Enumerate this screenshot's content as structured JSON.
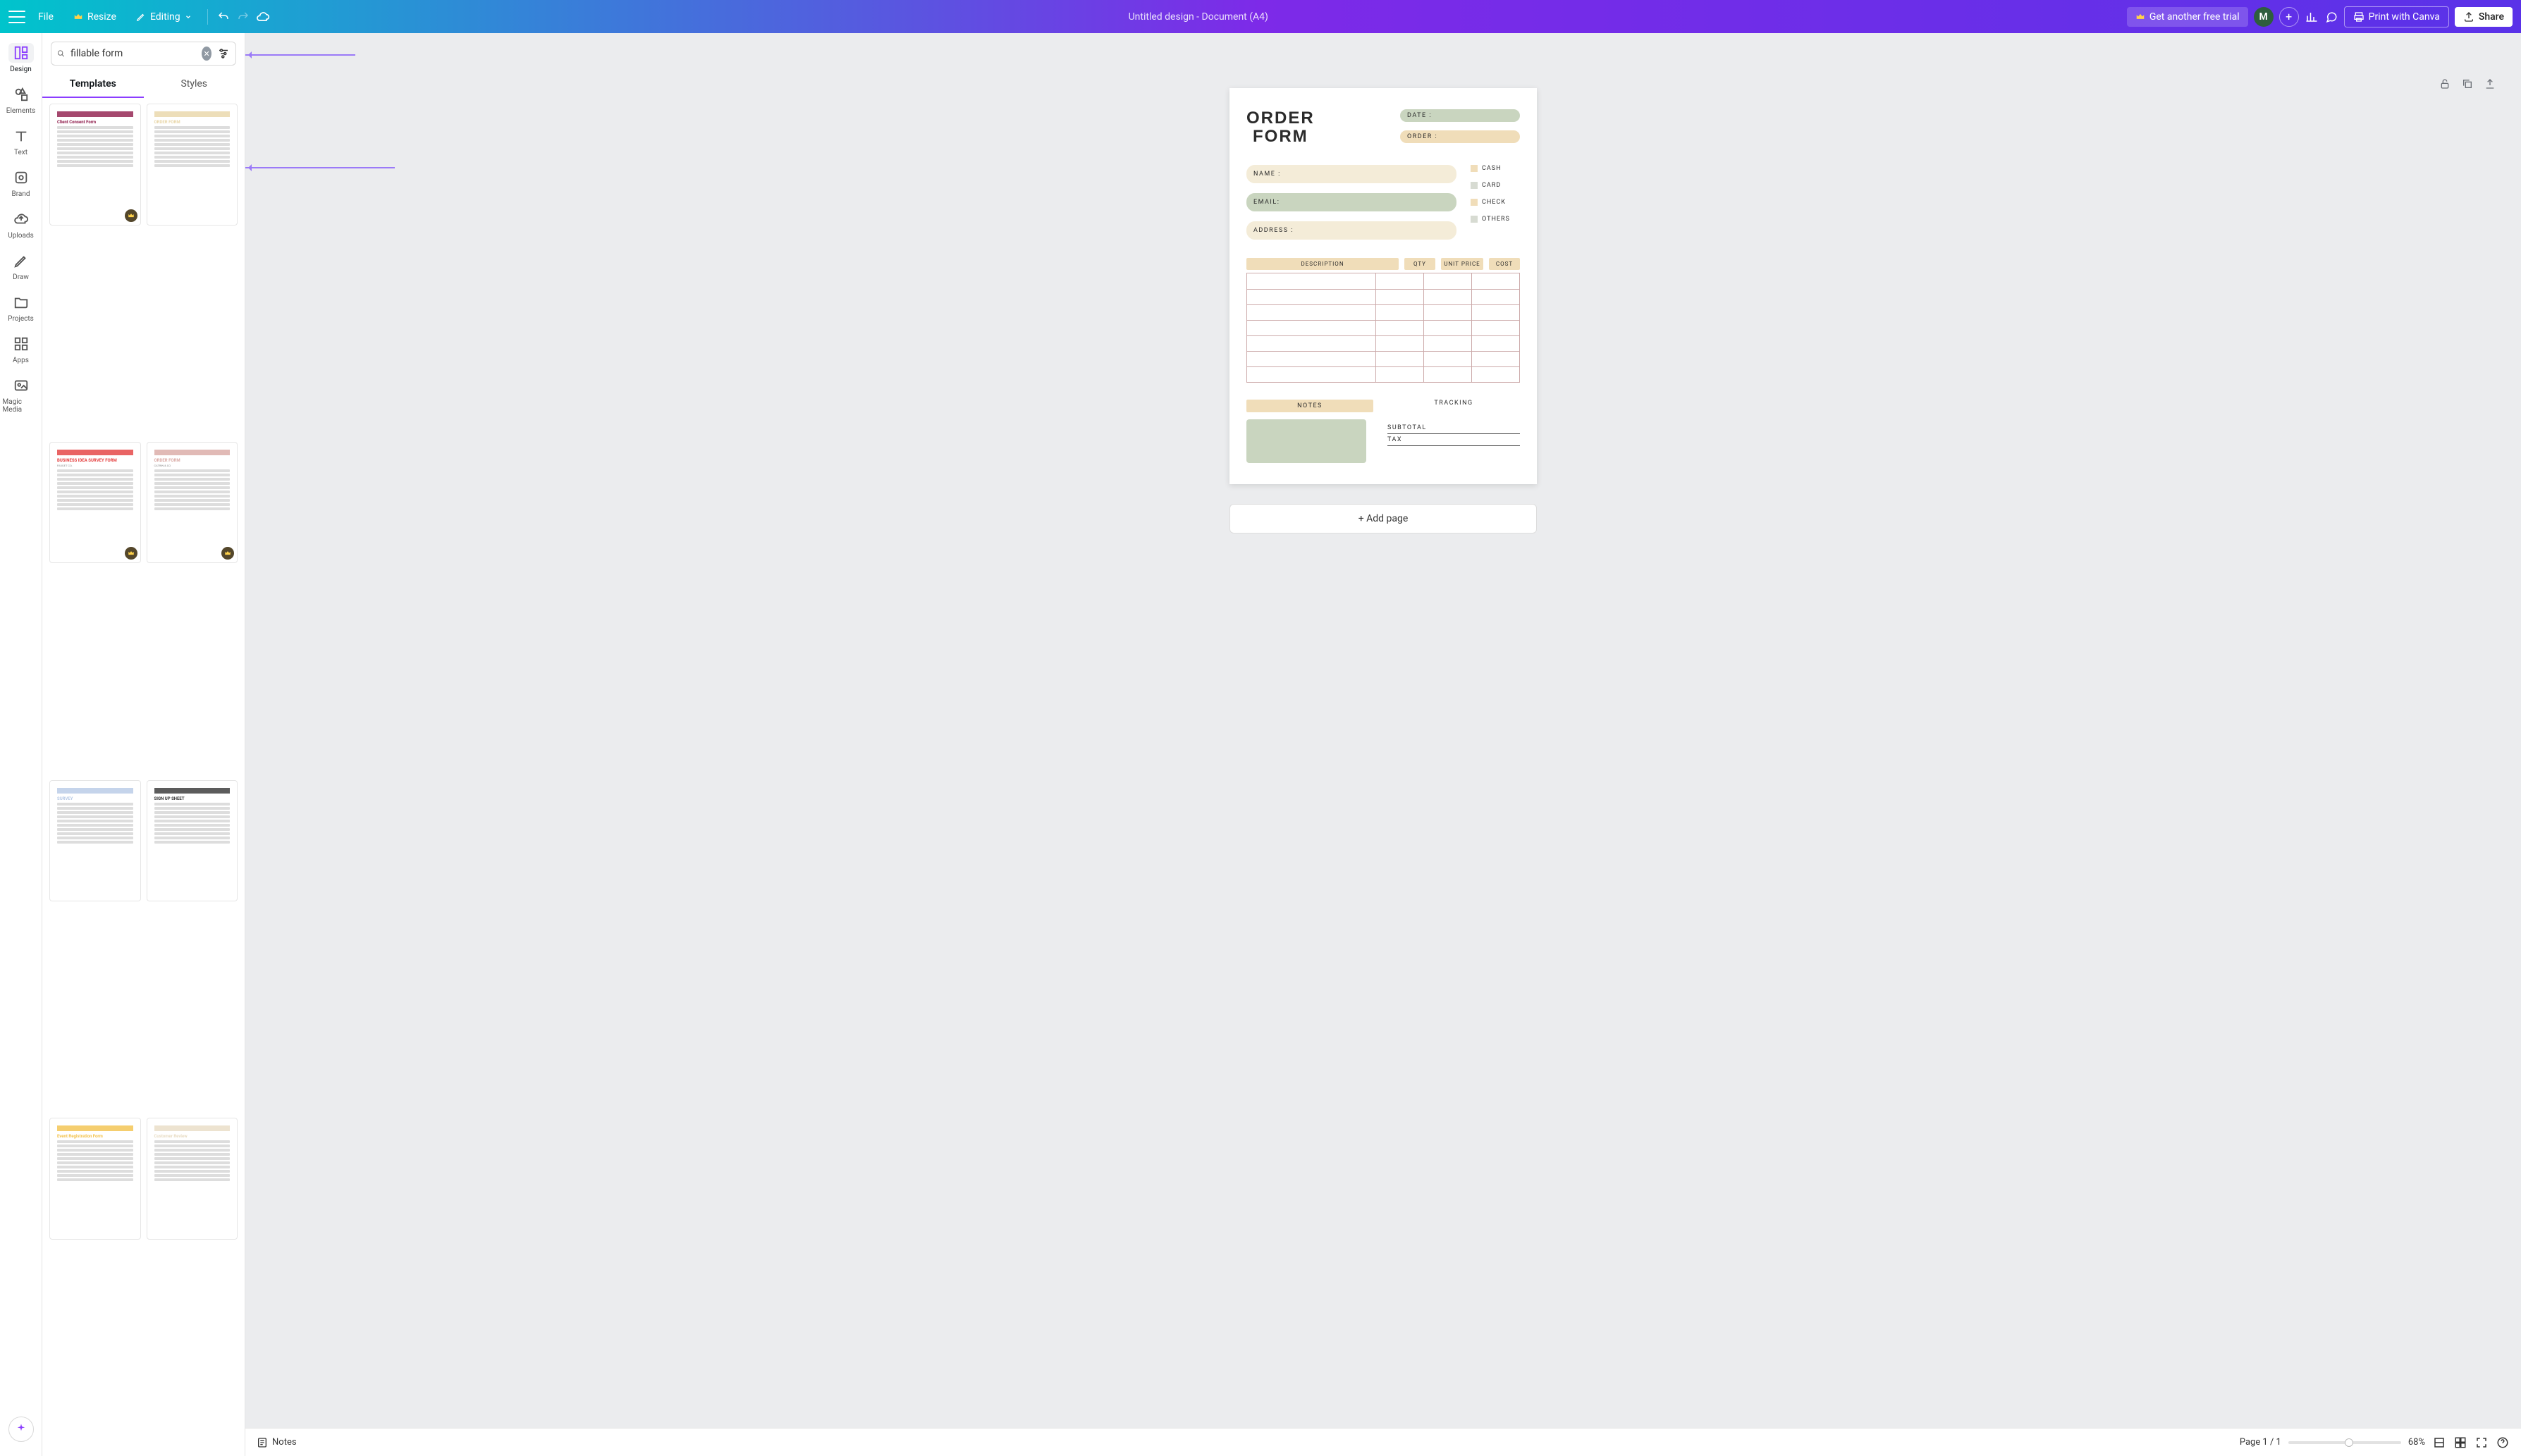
{
  "topbar": {
    "file": "File",
    "resize": "Resize",
    "editing": "Editing",
    "title": "Untitled design - Document (A4)",
    "trial": "Get another free trial",
    "avatar_initial": "M",
    "print": "Print with Canva",
    "share": "Share"
  },
  "rail": {
    "design": "Design",
    "elements": "Elements",
    "text": "Text",
    "brand": "Brand",
    "uploads": "Uploads",
    "draw": "Draw",
    "projects": "Projects",
    "apps": "Apps",
    "magic_media": "Magic Media"
  },
  "sidepanel": {
    "search_value": "fillable form",
    "tab_templates": "Templates",
    "tab_styles": "Styles",
    "thumbs": [
      {
        "title": "Client Consent Form",
        "premium": true,
        "accent": "#8e1a4a"
      },
      {
        "title": "ORDER FORM",
        "premium": false,
        "accent": "#e8d6a8"
      },
      {
        "title": "BUSINESS IDEA SURVEY FORM",
        "sub": "FAUGET CO.",
        "premium": true,
        "accent": "#e43d3d"
      },
      {
        "title": "ORDER FORM",
        "sub": "CATRIN & CO",
        "premium": true,
        "accent": "#d9a9a4"
      },
      {
        "title": "SURVEY",
        "premium": false,
        "accent": "#b6c9e6"
      },
      {
        "title": "SIGN UP SHEET",
        "premium": false,
        "accent": "#333333"
      },
      {
        "title": "Event Registration Form",
        "premium": false,
        "accent": "#f2c24b"
      },
      {
        "title": "Customer Review",
        "premium": false,
        "accent": "#e8dcc4"
      }
    ]
  },
  "document": {
    "title_line1": "ORDER",
    "title_line2": "FORM",
    "date_label": "DATE :",
    "order_label": "ORDER :",
    "name_label": "NAME :",
    "email_label": "EMAIL:",
    "address_label": "ADDRESS :",
    "pay_cash": "CASH",
    "pay_card": "CARD",
    "pay_check": "CHECK",
    "pay_others": "OTHERS",
    "col_desc": "DESCRIPTION",
    "col_qty": "QTY",
    "col_unit": "UNIT PRICE",
    "col_cost": "COST",
    "table_rows": 7,
    "notes_h": "NOTES",
    "tracking_h": "TRACKING",
    "subtotal": "SUBTOTAL",
    "tax": "TAX"
  },
  "addpage": "+ Add page",
  "bottombar": {
    "notes": "Notes",
    "page_indicator": "Page 1 / 1",
    "zoom": "68%"
  }
}
